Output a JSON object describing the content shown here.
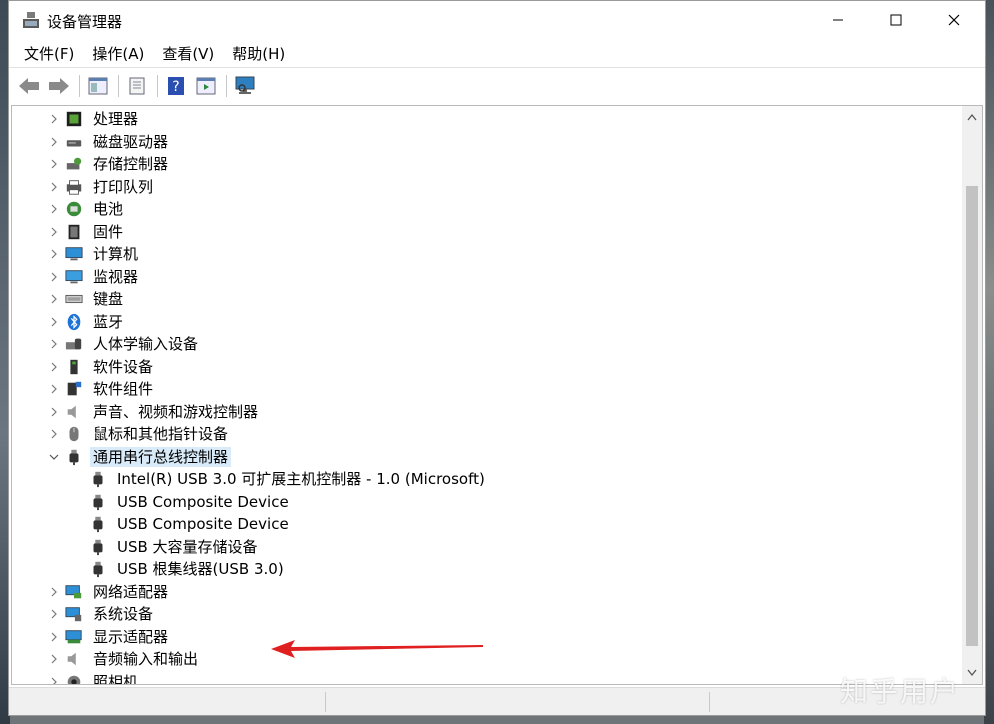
{
  "window": {
    "title": "设备管理器"
  },
  "menu": [
    {
      "label": "文件(F)"
    },
    {
      "label": "操作(A)"
    },
    {
      "label": "查看(V)"
    },
    {
      "label": "帮助(H)"
    }
  ],
  "tree": {
    "categories_before": [
      {
        "label": "处理器",
        "icon": "cpu-icon"
      },
      {
        "label": "磁盘驱动器",
        "icon": "disk-drive-icon"
      },
      {
        "label": "存储控制器",
        "icon": "storage-controller-icon"
      },
      {
        "label": "打印队列",
        "icon": "printer-icon"
      },
      {
        "label": "电池",
        "icon": "battery-icon"
      },
      {
        "label": "固件",
        "icon": "firmware-icon"
      },
      {
        "label": "计算机",
        "icon": "computer-icon"
      },
      {
        "label": "监视器",
        "icon": "monitor-icon"
      },
      {
        "label": "键盘",
        "icon": "keyboard-icon"
      },
      {
        "label": "蓝牙",
        "icon": "bluetooth-icon"
      },
      {
        "label": "人体学输入设备",
        "icon": "hid-icon"
      },
      {
        "label": "软件设备",
        "icon": "software-device-icon"
      },
      {
        "label": "软件组件",
        "icon": "software-component-icon"
      },
      {
        "label": "声音、视频和游戏控制器",
        "icon": "speaker-icon"
      },
      {
        "label": "鼠标和其他指针设备",
        "icon": "mouse-icon"
      }
    ],
    "expanded": {
      "label": "通用串行总线控制器",
      "icon": "usb-icon",
      "children": [
        {
          "label": "Intel(R) USB 3.0 可扩展主机控制器 - 1.0 (Microsoft)"
        },
        {
          "label": "USB Composite Device"
        },
        {
          "label": "USB Composite Device"
        },
        {
          "label": "USB 大容量存储设备"
        },
        {
          "label": "USB 根集线器(USB 3.0)"
        }
      ]
    },
    "categories_after": [
      {
        "label": "网络适配器",
        "icon": "network-adapter-icon"
      },
      {
        "label": "系统设备",
        "icon": "system-device-icon"
      },
      {
        "label": "显示适配器",
        "icon": "display-adapter-icon"
      },
      {
        "label": "音频输入和输出",
        "icon": "audio-io-icon"
      },
      {
        "label": "照相机",
        "icon": "camera-icon"
      }
    ]
  },
  "watermark": "知乎用户",
  "colors": {
    "selection": "#d9ebf9",
    "annotation_arrow": "#e02020"
  }
}
